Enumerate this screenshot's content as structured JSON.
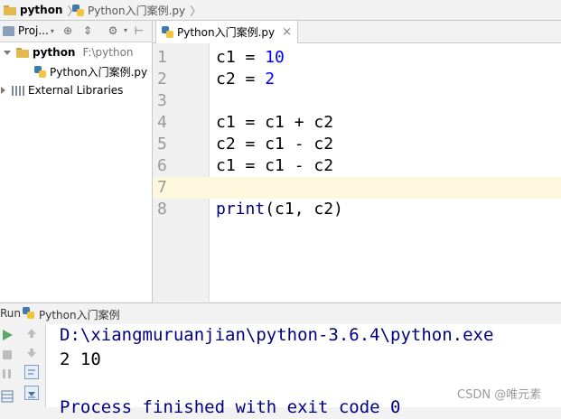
{
  "breadcrumb": {
    "project": "python",
    "file": "Python入门案例.py"
  },
  "project_panel": {
    "view_label": "Proj...",
    "root_name": "python",
    "root_path": "F:\\python",
    "file_item": "Python入门案例.py",
    "external_libraries": "External Libraries"
  },
  "editor": {
    "tab_label": "Python入门案例.py",
    "line_numbers": [
      "1",
      "2",
      "3",
      "4",
      "5",
      "6",
      "7",
      "8"
    ],
    "lines": [
      {
        "var": "c1 = ",
        "num": "10"
      },
      {
        "var": "c2 = ",
        "num": "2"
      },
      {
        "text": ""
      },
      {
        "text": "c1 = c1 + c2"
      },
      {
        "text": "c2 = c1 - c2"
      },
      {
        "text": "c1 = c1 - c2"
      },
      {
        "text": ""
      },
      {
        "func": "print",
        "args": "(c1, c2)"
      }
    ]
  },
  "run_panel": {
    "run_label": "Run",
    "config_name": "Python入门案例",
    "console": [
      "D:\\xiangmuruanjian\\python-3.6.4\\python.exe",
      "2 10",
      "",
      "Process finished with exit code 0"
    ]
  },
  "watermark": "CSDN @唯元素",
  "colors": {
    "keyword_number": "#0000ff",
    "builtin": "#000080",
    "current_line": "#fdf7dd",
    "run_green": "#59a869"
  }
}
